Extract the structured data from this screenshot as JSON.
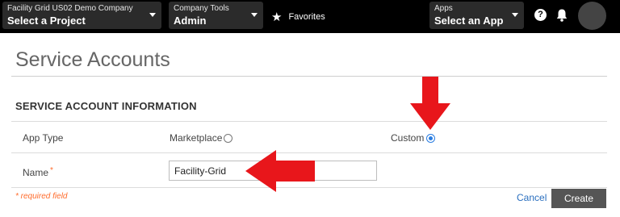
{
  "topbar": {
    "project": {
      "label": "Facility Grid US02 Demo Company",
      "value": "Select a Project"
    },
    "tools": {
      "label": "Company Tools",
      "value": "Admin"
    },
    "favorites": "Favorites",
    "apps": {
      "label": "Apps",
      "value": "Select an App"
    },
    "help_glyph": "?"
  },
  "page": {
    "title": "Service Accounts"
  },
  "form": {
    "section_title": "SERVICE ACCOUNT INFORMATION",
    "app_type_label": "App Type",
    "options": [
      {
        "label": "Marketplace",
        "selected": false
      },
      {
        "label": "Custom",
        "selected": true
      }
    ],
    "name_label": "Name",
    "required_mark": "*",
    "name_value": "Facility-Grid",
    "required_note": "* required field",
    "cancel_label": "Cancel",
    "create_label": "Create"
  },
  "colors": {
    "arrow": "#e8161b",
    "radio_selected": "#2a7de1",
    "required": "#ff6b2b",
    "link": "#2a6fbf",
    "button": "#555555"
  },
  "icons": [
    "chevron-down-icon",
    "star-icon",
    "help-icon",
    "bell-icon",
    "avatar",
    "arrow-down-icon",
    "arrow-left-icon"
  ]
}
